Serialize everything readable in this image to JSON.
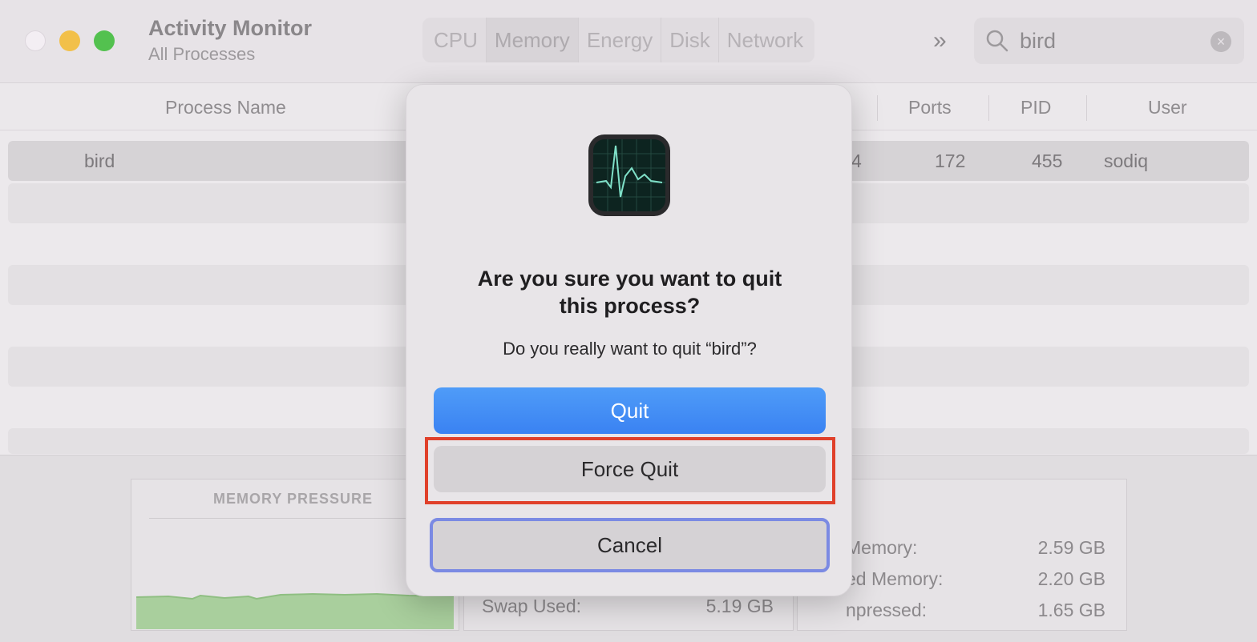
{
  "window": {
    "title": "Activity Monitor",
    "subtitle": "All Processes"
  },
  "toolbar": {
    "tabs": [
      {
        "label": "CPU",
        "active": false
      },
      {
        "label": "Memory",
        "active": true
      },
      {
        "label": "Energy",
        "active": false
      },
      {
        "label": "Disk",
        "active": false
      },
      {
        "label": "Network",
        "active": false
      }
    ],
    "overflow_icon": "chevron-double-right-icon",
    "search": {
      "value": "bird",
      "icon": "search-icon",
      "clear_icon": "clear-icon"
    }
  },
  "table": {
    "columns": [
      "Process Name",
      "Ports",
      "PID",
      "User"
    ],
    "rows": [
      {
        "process": "bird",
        "partial": "4",
        "ports": "172",
        "pid": "455",
        "user": "sodiq"
      }
    ]
  },
  "bottom": {
    "memory_pressure_label": "MEMORY PRESSURE",
    "swap_used_label": "Swap Used:",
    "swap_used_value": "5.19 GB",
    "stats": [
      {
        "label": "Memory:",
        "value": "2.59 GB"
      },
      {
        "label": "ed Memory:",
        "value": "2.20 GB"
      },
      {
        "label": "npressed:",
        "value": "1.65 GB"
      }
    ]
  },
  "dialog": {
    "icon": "activity-monitor-icon",
    "title_line1": "Are you sure you want to quit",
    "title_line2": "this process?",
    "message": "Do you really want to quit “bird”?",
    "quit_label": "Quit",
    "force_quit_label": "Force Quit",
    "cancel_label": "Cancel"
  },
  "colors": {
    "accent_blue": "#3a82f2",
    "highlight_red": "#e0402a",
    "focus_ring": "#7b8ae3",
    "graph_green": "#a9cf9d"
  }
}
